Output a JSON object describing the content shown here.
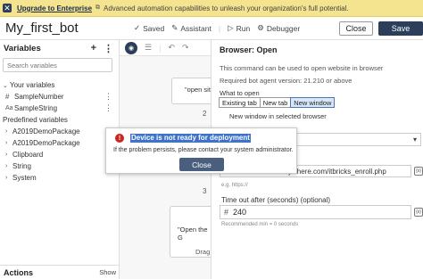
{
  "banner": {
    "close_icon": "close-icon",
    "link": "Upgrade to Enterprise",
    "message": "Advanced automation capabilities to unleash your organization's full potential."
  },
  "header": {
    "title": "My_first_bot",
    "saved": "Saved",
    "assistant": "Assistant",
    "run": "Run",
    "debugger": "Debugger",
    "close": "Close",
    "save": "Save"
  },
  "variables": {
    "title": "Variables",
    "search_placeholder": "Search variables",
    "your_variables": "Your variables",
    "items": [
      "SampleNumber",
      "SampleString"
    ],
    "predefined": "Predefined variables",
    "predefined_items": [
      "A2019DemoPackage",
      "A2019DemoPackage",
      "Clipboard",
      "String",
      "System"
    ]
  },
  "actions": {
    "title": "Actions",
    "show": "Show"
  },
  "canvas": {
    "card1_text": "\"open sit",
    "step2": "2",
    "step3": "3",
    "card2_text": "\"Open the G",
    "card2_sub": "Drag"
  },
  "properties": {
    "title": "Browser: Open",
    "description": "This command can be used to open website in browser",
    "requirement": "Required bot agent version: 21.210 or above",
    "what_to_open": "What to open",
    "options": [
      "Existing tab",
      "New tab",
      "New window"
    ],
    "selected_option": "New window",
    "new_window_label": "New window in selected browser",
    "url_value": "ywhere.com/itbricks_enroll.php",
    "example": "e.g. https://",
    "timeout_label": "Time out after (seconds) (optional)",
    "timeout_value": "240",
    "recommended": "Recommended min = 0 seconds"
  },
  "dialog": {
    "title": "Device is not ready for deployment",
    "message": "If the problem persists, please contact your system administrator.",
    "close": "Close"
  }
}
